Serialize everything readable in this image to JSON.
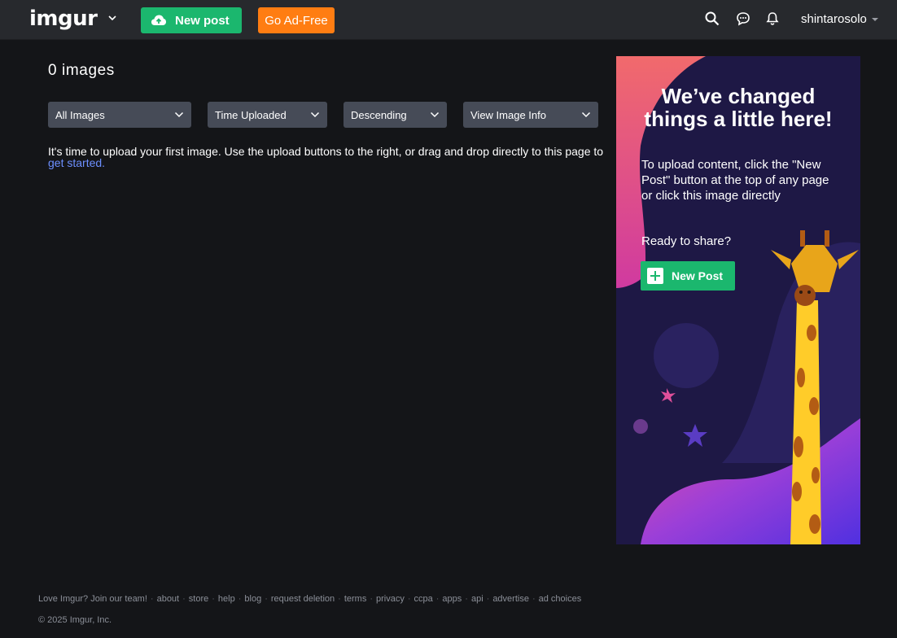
{
  "header": {
    "logo_text": "imgur",
    "new_post_label": "New post",
    "ad_free_label": "Go Ad-Free",
    "username": "shintarosolo",
    "icons": [
      "search-icon",
      "chat-icon",
      "bell-icon"
    ],
    "colors": {
      "new_post": "#1bb76e",
      "ad_free": "#ff7d12",
      "bar": "#27292d"
    }
  },
  "main": {
    "image_count": "0 images",
    "filters": [
      {
        "label": "All Images"
      },
      {
        "label": "Time Uploaded"
      },
      {
        "label": "Descending"
      },
      {
        "label": "View Image Info"
      }
    ],
    "empty_message": "It's time to upload your first image. Use the upload buttons to the right, or drag and drop directly to this page to ",
    "get_started_link": "get started."
  },
  "promo": {
    "heading_line1": "We’ve changed",
    "heading_line2": "things a little here!",
    "body": "To upload content, click the \"New Post\" button at the top of any page or click this image directly",
    "ready": "Ready to share?",
    "button_label": "New Post"
  },
  "footer": {
    "links": [
      "Love Imgur? Join our team!",
      "about",
      "store",
      "help",
      "blog",
      "request deletion",
      "terms",
      "privacy",
      "ccpa",
      "apps",
      "api",
      "advertise",
      "ad choices"
    ],
    "copyright": "© 2025 Imgur, Inc."
  }
}
